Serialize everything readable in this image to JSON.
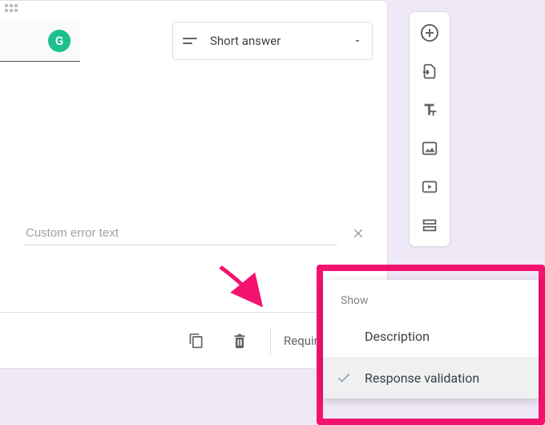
{
  "question": {
    "type_label": "Short answer",
    "error_placeholder": "Custom error text"
  },
  "footer": {
    "required_label": "Required"
  },
  "menu": {
    "header": "Show",
    "item_description": "Description",
    "item_response_validation": "Response validation"
  },
  "toolbar": {
    "add": "Add question",
    "import": "Import questions",
    "title": "Add title and description",
    "image": "Add image",
    "video": "Add video",
    "section": "Add section"
  }
}
